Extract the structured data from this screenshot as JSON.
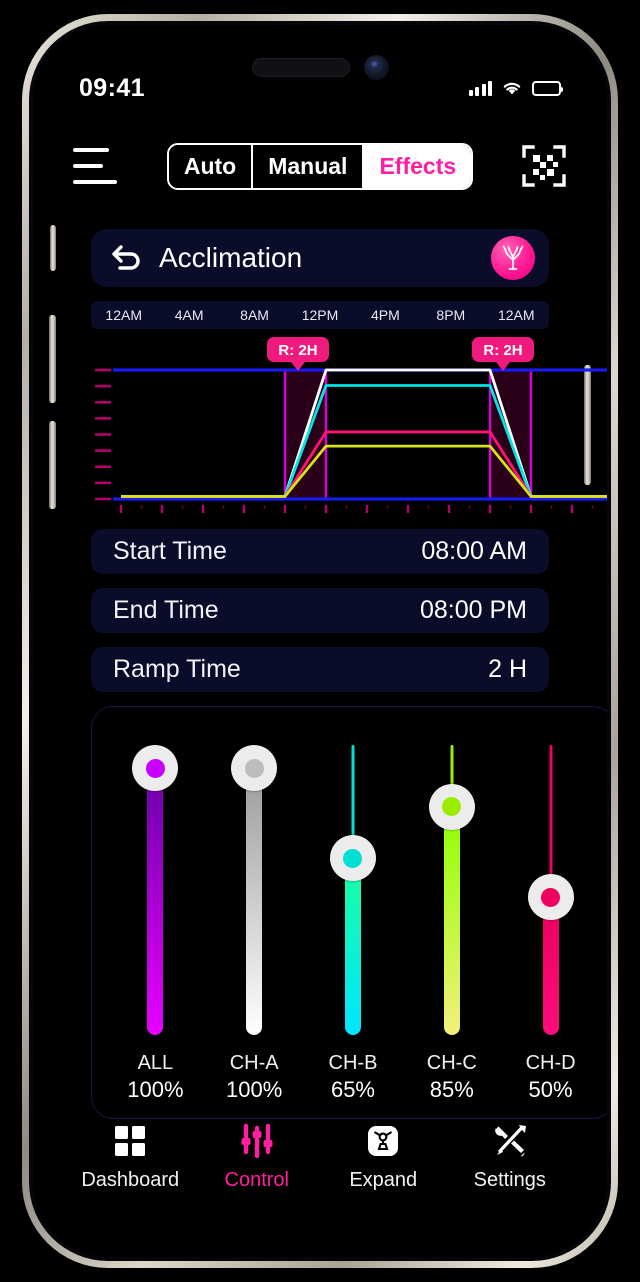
{
  "status_bar": {
    "time": "09:41",
    "signal_icon": "cellular-signal-icon",
    "wifi_icon": "wifi-icon",
    "battery_icon": "battery-icon"
  },
  "top_bar": {
    "menu_icon": "hamburger-menu-icon",
    "scan_icon": "qr-scan-icon",
    "segments": [
      {
        "label": "Auto",
        "active": false
      },
      {
        "label": "Manual",
        "active": false
      },
      {
        "label": "Effects",
        "active": true
      }
    ],
    "active_color": "#ff1fa0"
  },
  "title_card": {
    "back_icon": "back-arrow-icon",
    "title": "Acclimation",
    "badge_icon": "coral-tree-icon",
    "badge_color": "#ff1a93"
  },
  "time_axis": {
    "ticks": [
      "12AM",
      "4AM",
      "8AM",
      "12PM",
      "4PM",
      "8PM",
      "12AM"
    ]
  },
  "chart_data": {
    "type": "line",
    "title": "",
    "xlabel": "",
    "ylabel": "",
    "x": [
      "12AM",
      "4AM",
      "8AM",
      "12PM",
      "4PM",
      "8PM",
      "12AM"
    ],
    "xlim": [
      0,
      24
    ],
    "ylim": [
      0,
      100
    ],
    "grid": false,
    "legend": "none",
    "ramp_label": "R: 2H",
    "ramp_badge_color": "#ee1a7d",
    "ramp_zones": [
      {
        "start_hour": 8,
        "end_hour": 10,
        "label": "R: 2H"
      },
      {
        "start_hour": 18,
        "end_hour": 20,
        "label": "R: 2H"
      }
    ],
    "boundary_line_color": "#1b1bf0",
    "axis_tick_color": "#b5006e",
    "y_tick_count": 9,
    "series": [
      {
        "name": "CH-A",
        "color": "#ffffff",
        "points": [
          [
            0,
            2
          ],
          [
            8,
            2
          ],
          [
            10,
            100
          ],
          [
            18,
            100
          ],
          [
            20,
            2
          ],
          [
            24,
            2
          ]
        ],
        "plateau": 100
      },
      {
        "name": "CH-B",
        "color": "#00e5e5",
        "points": [
          [
            0,
            2
          ],
          [
            8,
            2
          ],
          [
            10,
            88
          ],
          [
            18,
            88
          ],
          [
            20,
            2
          ],
          [
            24,
            2
          ]
        ],
        "plateau": 65
      },
      {
        "name": "CH-D",
        "color": "#ff1372",
        "points": [
          [
            0,
            2
          ],
          [
            8,
            2
          ],
          [
            10,
            52
          ],
          [
            18,
            52
          ],
          [
            20,
            2
          ],
          [
            24,
            2
          ]
        ],
        "plateau": 50
      },
      {
        "name": "CH-C",
        "color": "#d7e21a",
        "points": [
          [
            0,
            2
          ],
          [
            8,
            2
          ],
          [
            10,
            41
          ],
          [
            18,
            41
          ],
          [
            20,
            2
          ],
          [
            24,
            2
          ]
        ],
        "plateau": 85
      }
    ]
  },
  "info_rows": [
    {
      "label": "Start Time",
      "value": "08:00 AM"
    },
    {
      "label": "End Time",
      "value": "08:00 PM"
    },
    {
      "label": "Ramp Time",
      "value": "2 H"
    }
  ],
  "sliders": [
    {
      "name": "ALL",
      "percent": "100%",
      "value": 100,
      "color": "#c800ff",
      "grad_top": "#6a00a8",
      "grad_bottom": "#e800ff"
    },
    {
      "name": "CH-A",
      "percent": "100%",
      "value": 100,
      "color": "#bdbdbd",
      "grad_top": "#9a9a9a",
      "grad_bottom": "#ffffff"
    },
    {
      "name": "CH-B",
      "percent": "65%",
      "value": 65,
      "color": "#00e0d2",
      "grad_top": "#1bff9e",
      "grad_bottom": "#00e5ff"
    },
    {
      "name": "CH-C",
      "percent": "85%",
      "value": 85,
      "color": "#9bec00",
      "grad_top": "#8eff00",
      "grad_bottom": "#f3f07a"
    },
    {
      "name": "CH-D",
      "percent": "50%",
      "value": 50,
      "color": "#f0005f",
      "grad_top": "#e8005f",
      "grad_bottom": "#ff0c7a"
    }
  ],
  "bottom_nav": [
    {
      "label": "Dashboard",
      "icon": "grid-icon",
      "active": false
    },
    {
      "label": "Control",
      "icon": "sliders-icon",
      "active": true
    },
    {
      "label": "Expand",
      "icon": "device-icon",
      "active": false
    },
    {
      "label": "Settings",
      "icon": "tools-icon",
      "active": false
    }
  ]
}
